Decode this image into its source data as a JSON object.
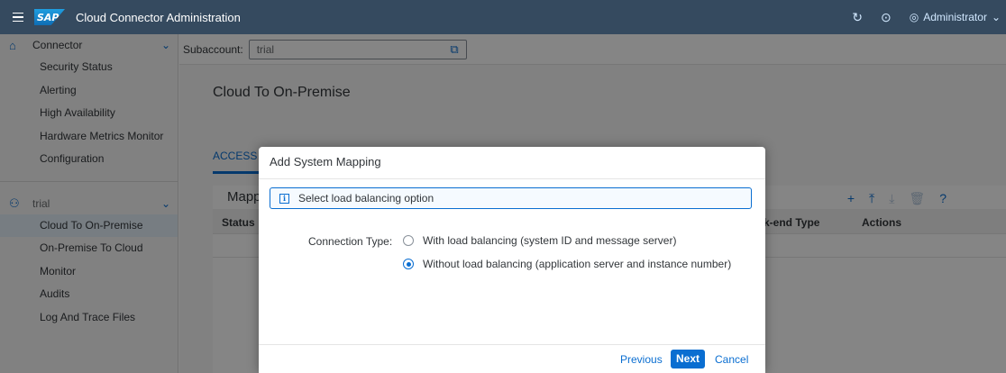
{
  "shell": {
    "logo_text": "SAP",
    "title": "Cloud Connector Administration",
    "refresh_icon": "refresh-icon",
    "logout_icon": "logout-icon",
    "user_icon": "user-icon",
    "user": "Administrator",
    "user_chevron": "⌄"
  },
  "sidebar": {
    "connector": {
      "label": "Connector",
      "items": [
        "Security Status",
        "Alerting",
        "High Availability",
        "Hardware Metrics Monitor",
        "Configuration"
      ]
    },
    "subaccount": {
      "label": "trial",
      "items": [
        "Cloud To On-Premise",
        "On-Premise To Cloud",
        "Monitor",
        "Audits",
        "Log And Trace Files"
      ],
      "selected": "Cloud To On-Premise"
    }
  },
  "main": {
    "subaccount_label": "Subaccount:",
    "subaccount_value": "trial",
    "page_title": "Cloud To On-Premise",
    "tab_label": "ACCESS C",
    "card_title": "Mapp",
    "columns": [
      "Status",
      "k-end Type",
      "Actions"
    ]
  },
  "dialog": {
    "title": "Add System Mapping",
    "info_text": "Select load balancing option",
    "connection_label": "Connection Type:",
    "options": [
      {
        "label": "With load balancing (system ID and message server)",
        "checked": false
      },
      {
        "label": "Without load balancing (application server and instance number)",
        "checked": true
      }
    ],
    "previous_label": "Previous",
    "next_label": "Next",
    "cancel_label": "Cancel"
  },
  "colors": {
    "shell": "#354a5f",
    "accent": "#0a6ed1"
  }
}
